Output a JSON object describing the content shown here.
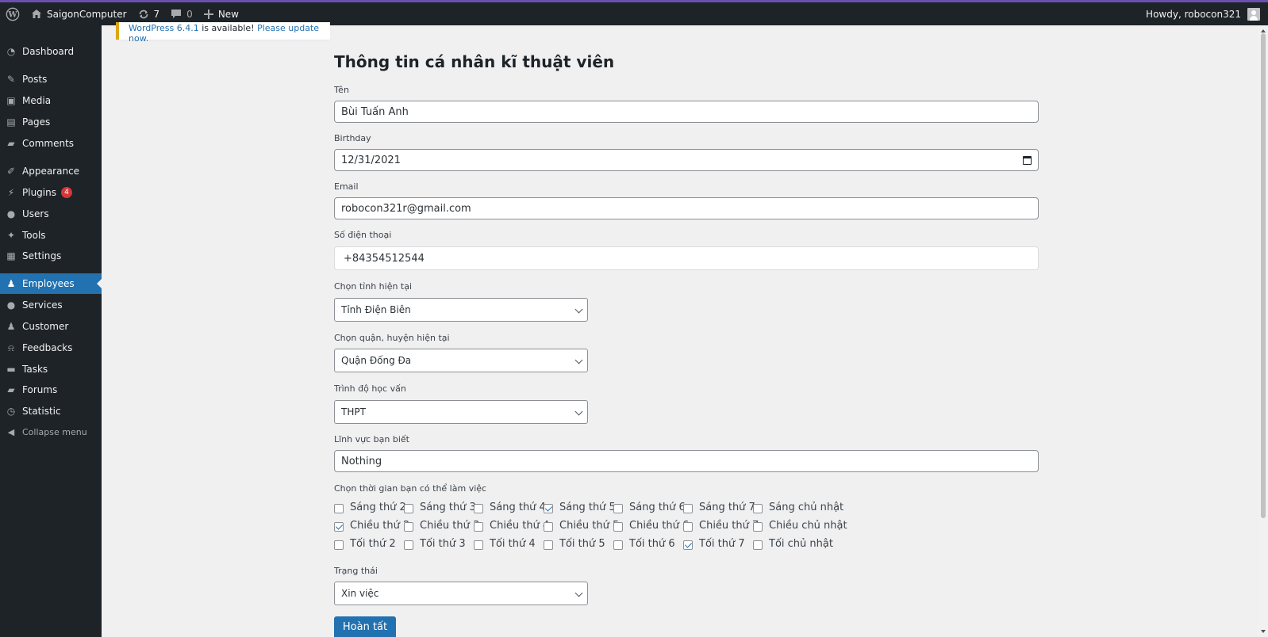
{
  "adminbar": {
    "site_name": "SaigonComputer",
    "updates_count": "7",
    "comments_count": "0",
    "new_label": "New",
    "howdy": "Howdy, robocon321"
  },
  "sidebar": {
    "items": [
      {
        "label": "Dashboard",
        "icon": "dashboard-icon"
      },
      {
        "label": "Posts",
        "icon": "pin-icon"
      },
      {
        "label": "Media",
        "icon": "media-icon"
      },
      {
        "label": "Pages",
        "icon": "pages-icon"
      },
      {
        "label": "Comments",
        "icon": "comment-icon"
      },
      {
        "label": "Appearance",
        "icon": "brush-icon"
      },
      {
        "label": "Plugins",
        "icon": "plugin-icon",
        "badge": "4"
      },
      {
        "label": "Users",
        "icon": "user-icon"
      },
      {
        "label": "Tools",
        "icon": "wrench-icon"
      },
      {
        "label": "Settings",
        "icon": "settings-icon"
      },
      {
        "label": "Employees",
        "icon": "groups-icon",
        "current": true
      },
      {
        "label": "Services",
        "icon": "user-icon"
      },
      {
        "label": "Customer",
        "icon": "users-icon"
      },
      {
        "label": "Feedbacks",
        "icon": "bell-icon"
      },
      {
        "label": "Tasks",
        "icon": "forms-icon"
      },
      {
        "label": "Forums",
        "icon": "forums-icon"
      },
      {
        "label": "Statistic",
        "icon": "clock-icon"
      }
    ],
    "collapse_label": "Collapse menu"
  },
  "notice": {
    "version_link": "WordPress 6.4.1",
    "text": " is available! ",
    "update_link": "Please update now."
  },
  "form": {
    "title": "Thông tin cá nhân kĩ thuật viên",
    "name_label": "Tên",
    "name_value": "Bùi Tuấn Anh",
    "birthday_label": "Birthday",
    "birthday_value": "12/31/2021",
    "email_label": "Email",
    "email_value": "robocon321r@gmail.com",
    "phone_label": "Số điện thoại",
    "phone_value": "+84354512544",
    "province_label": "Chọn tỉnh hiện tại",
    "province_value": "Tỉnh Điện Biên",
    "district_label": "Chọn quận, huyện hiện tại",
    "district_value": "Quận Đống Đa",
    "education_label": "Trình độ học vấn",
    "education_value": "THPT",
    "field_label": "Lĩnh vực bạn biết",
    "field_value": "Nothing",
    "schedule_label": "Chọn thời gian bạn có thể làm việc",
    "schedule": [
      [
        {
          "label": "Sáng thứ 2",
          "checked": false
        },
        {
          "label": "Sáng thứ 3",
          "checked": false
        },
        {
          "label": "Sáng thứ 4",
          "checked": false
        },
        {
          "label": "Sáng thứ 5",
          "checked": true
        },
        {
          "label": "Sáng thứ 6",
          "checked": false
        },
        {
          "label": "Sáng thứ 7",
          "checked": false
        },
        {
          "label": "Sáng chủ nhật",
          "checked": false
        }
      ],
      [
        {
          "label": "Chiều thứ 2",
          "checked": true
        },
        {
          "label": "Chiều thứ 3",
          "checked": false
        },
        {
          "label": "Chiều thứ 4",
          "checked": false
        },
        {
          "label": "Chiều thứ 5",
          "checked": false
        },
        {
          "label": "Chiều thứ 6",
          "checked": false
        },
        {
          "label": "Chiều thứ 7",
          "checked": false
        },
        {
          "label": "Chiều chủ nhật",
          "checked": false
        }
      ],
      [
        {
          "label": "Tối thứ 2",
          "checked": false
        },
        {
          "label": "Tối thứ 3",
          "checked": false
        },
        {
          "label": "Tối thứ 4",
          "checked": false
        },
        {
          "label": "Tối thứ 5",
          "checked": false
        },
        {
          "label": "Tối thứ 6",
          "checked": false
        },
        {
          "label": "Tối thứ 7",
          "checked": true
        },
        {
          "label": "Tối chủ nhật",
          "checked": false
        }
      ]
    ],
    "status_label": "Trạng thái",
    "status_value": "Xin việc",
    "submit_label": "Hoàn tất"
  }
}
